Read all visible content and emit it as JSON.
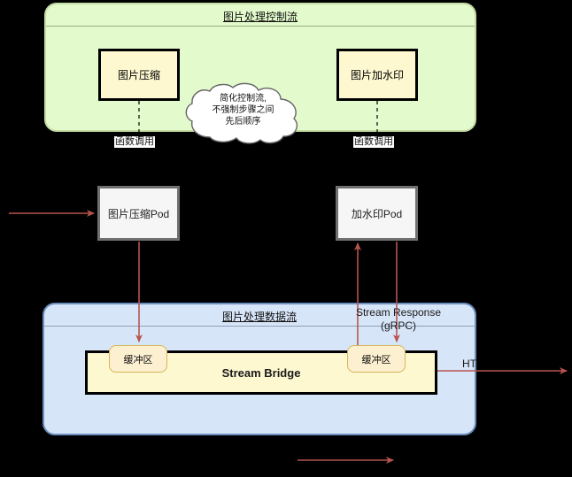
{
  "diagram": {
    "title_control_flow": "图片处理控制流",
    "title_data_flow": "图片处理数据流"
  },
  "control_flow": {
    "boxes": [
      {
        "label": "图片压缩"
      },
      {
        "label": "图片加水印"
      }
    ],
    "edge_labels": [
      {
        "label": "函数调用"
      },
      {
        "label": "函数调用"
      }
    ],
    "note": {
      "line1": "简化控制流,",
      "line2": "不强制步骤之间",
      "line3": "先后顺序"
    }
  },
  "pods": [
    {
      "label": "图片压缩Pod"
    },
    {
      "label": "加水印Pod"
    }
  ],
  "data_flow": {
    "bridge_label": "Stream Bridge",
    "buffers": [
      {
        "label": "缓冲区"
      },
      {
        "label": "缓冲区"
      }
    ],
    "stream_response": "Stream Response\n(gRPC)",
    "stream_response_line1": "Stream Response",
    "stream_response_line2": "(gRPC)",
    "http_label": "HT"
  },
  "colors": {
    "control_group_fill": "#e3fbcc",
    "control_group_border": "#c3dba2",
    "data_group_fill": "#d7e5f8",
    "data_group_border": "#6c8ebf",
    "box_fill": "#fdf8d0",
    "box_border": "#000000",
    "pod_fill": "#f6f6f6",
    "pod_border": "#707070",
    "buffer_fill": "#fdf0d0",
    "buffer_border": "#d6b656",
    "arrow": "#b85450",
    "background": "#000000"
  }
}
